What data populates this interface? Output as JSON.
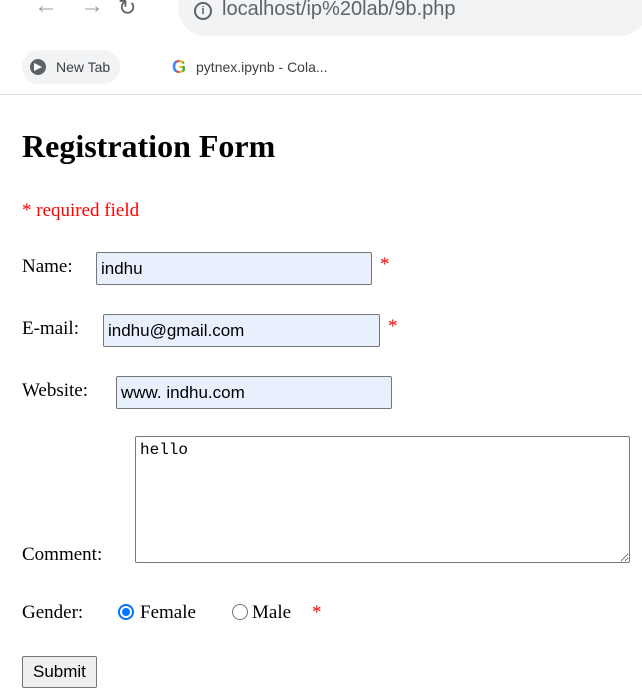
{
  "browser": {
    "url": "localhost/ip%20lab/9b.php",
    "bookmarks": [
      {
        "label": "New Tab",
        "icon": "globe-icon"
      },
      {
        "label": "pytnex.ipynb - Cola...",
        "icon": "google-icon"
      }
    ]
  },
  "form": {
    "title": "Registration Form",
    "required_note": "* required field",
    "star": "*",
    "name_label": "Name:",
    "name_value": "indhu",
    "email_label": "E-mail:",
    "email_value": "indhu@gmail.com",
    "website_label": "Website:",
    "website_value": "www. indhu.com",
    "comment_label": "Comment:",
    "comment_value": "hello",
    "gender_label": "Gender:",
    "gender_options": [
      "Female",
      "Male"
    ],
    "gender_selected": "Female",
    "submit_label": "Submit"
  },
  "colors": {
    "required": "#ff0000",
    "autofill": "#e8f0fe",
    "radio_accent": "#0075ff"
  }
}
